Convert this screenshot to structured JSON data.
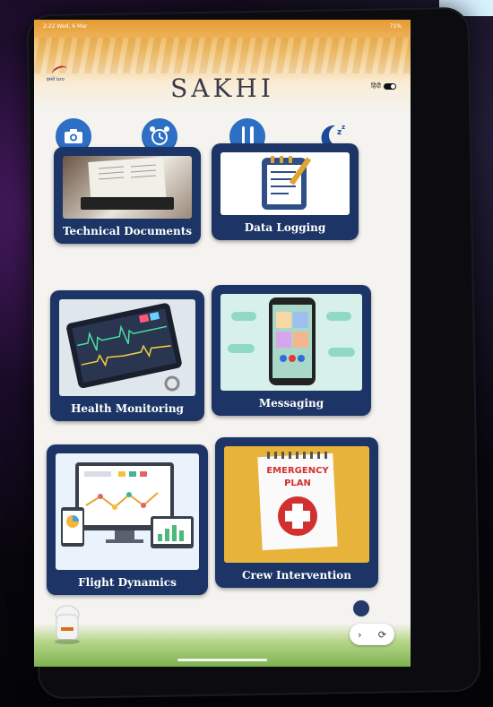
{
  "status": {
    "time": "2:22",
    "date": "Wed, 6 Mar",
    "battery": "71%"
  },
  "header": {
    "app_title": "SAKHI",
    "logo_text": "इसरो isro",
    "lang_label": "हिंदी"
  },
  "top_icons": [
    "camera-icon",
    "alarm-clock-icon",
    "fork-knife-icon",
    "sleep-moon-icon"
  ],
  "tiles": [
    {
      "label": "Technical Documents"
    },
    {
      "label": "Data Logging"
    },
    {
      "label": "Health Monitoring"
    },
    {
      "label": "Messaging"
    },
    {
      "label": "Flight Dynamics"
    },
    {
      "label": "Crew Intervention"
    }
  ],
  "emergency": {
    "line1": "EMERGENCY",
    "line2": "PLAN"
  },
  "colors": {
    "tile": "#1c3566",
    "accent": "#2c6fc4",
    "header": "#e6962a"
  }
}
